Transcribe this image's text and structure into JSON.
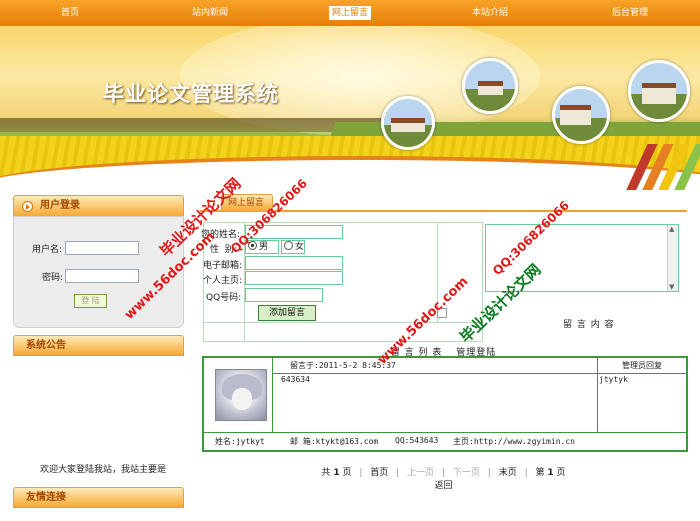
{
  "nav": {
    "items": [
      "首页",
      "站内新闻",
      "网上留言",
      "本站介绍",
      "后台管理"
    ],
    "active_index": 2
  },
  "banner": {
    "title": "毕业论文管理系统"
  },
  "sidebar": {
    "login": {
      "title": "用户登录",
      "username_label": "用户名:",
      "username_value": "",
      "password_label": "密码:",
      "password_value": "",
      "submit_label": "登 陆"
    },
    "notice": {
      "title": "系统公告",
      "text": "欢迎大家登陆我站，我站主要是"
    },
    "links": {
      "title": "友情连接"
    }
  },
  "guestbook": {
    "tab_label": "网上留言",
    "form": {
      "name_label": "您的姓名:",
      "name_value": "",
      "gender_label": "性  别:",
      "gender_options": [
        "男",
        "女"
      ],
      "gender_selected": "男",
      "email_label": "电子邮箱:",
      "email_value": "",
      "homepage_label": "个人主页:",
      "homepage_value": "",
      "qq_label": "QQ号码:",
      "qq_value": "",
      "submit_label": "添加留言",
      "content_label": "留 言 内 容"
    },
    "list": {
      "title": "留 言 列 表",
      "admin_login": "管理登陆",
      "admin_reply_header": "管理员回复",
      "entries": [
        {
          "time": "留言于:2011-5-2 8:45:37",
          "content": "643634",
          "reply": "jtytyk",
          "name": "姓名:jytkyt",
          "email": "邮 箱:ktykt@163.com",
          "qq": "QQ:543643",
          "homepage": "主页:http://www.zgyimin.cn"
        }
      ]
    },
    "pager": {
      "total_prefix": "共",
      "total_pages": "1",
      "total_suffix": "页",
      "first": "首页",
      "prev": "上一页",
      "next": "下一页",
      "last": "末页",
      "current_prefix": "第",
      "current_page": "1",
      "current_suffix": "页",
      "back": "返回"
    }
  },
  "watermarks": {
    "site_name": "毕业设计论文网",
    "url": "www.56doc.com",
    "qq": "QQ:306826066"
  },
  "colors": {
    "nav_orange": "#f08a10",
    "watermark_red": "#e01818",
    "watermark_green": "#0a7a1e",
    "table_green": "#3a9a3a"
  }
}
